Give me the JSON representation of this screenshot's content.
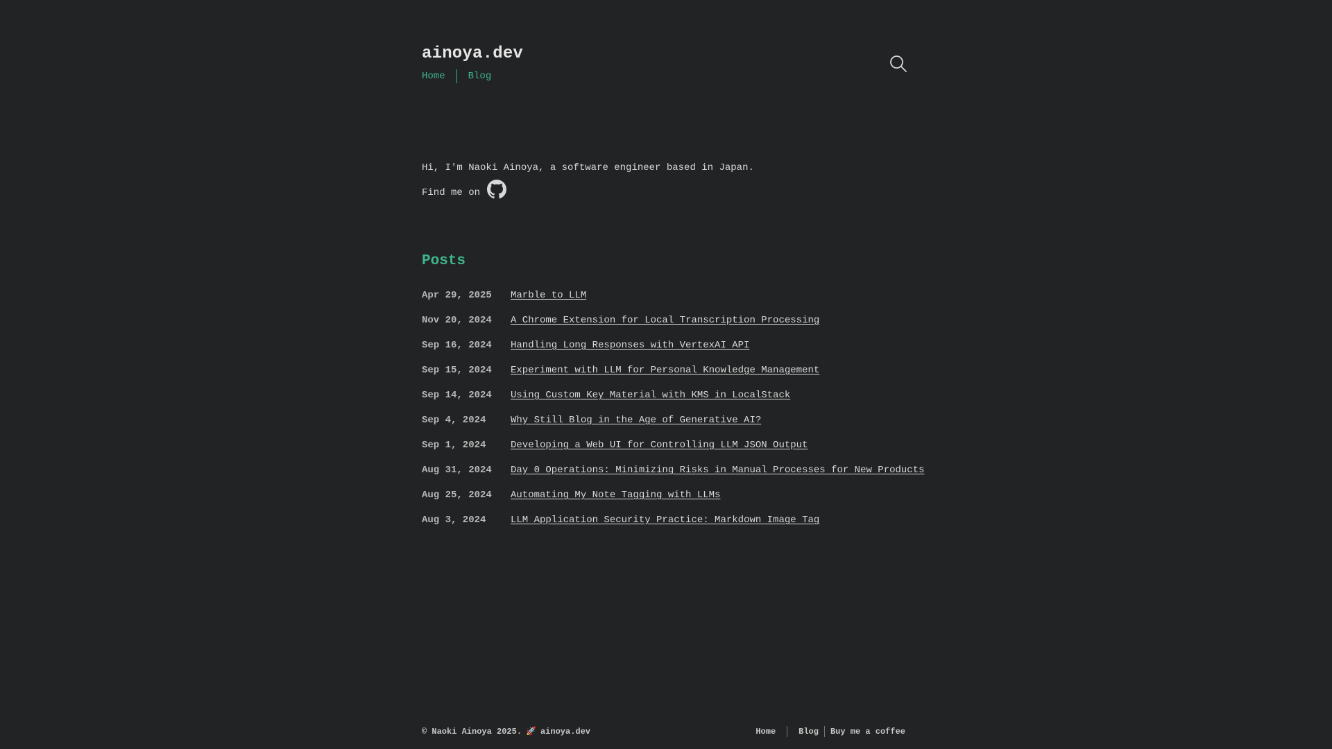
{
  "header": {
    "site_title": "ainoya.dev",
    "nav": [
      {
        "label": "Home"
      },
      {
        "label": "Blog"
      }
    ],
    "search_icon": "search-icon"
  },
  "intro": {
    "text": "Hi, I'm Naoki Ainoya, a software engineer based in Japan.",
    "find_me": "Find me on",
    "github_icon": "github-icon"
  },
  "posts": {
    "title": "Posts",
    "items": [
      {
        "date": "Apr 29, 2025",
        "title": "Marble to LLM"
      },
      {
        "date": "Nov 20, 2024",
        "title": "A Chrome Extension for Local Transcription Processing"
      },
      {
        "date": "Sep 16, 2024",
        "title": "Handling Long Responses with VertexAI API"
      },
      {
        "date": "Sep 15, 2024",
        "title": "Experiment with LLM for Personal Knowledge Management"
      },
      {
        "date": "Sep 14, 2024",
        "title": "Using Custom Key Material with KMS in LocalStack"
      },
      {
        "date": "Sep 4, 2024",
        "title": "Why Still Blog in the Age of Generative AI?"
      },
      {
        "date": "Sep 1, 2024",
        "title": "Developing a Web UI for Controlling LLM JSON Output"
      },
      {
        "date": "Aug 31, 2024",
        "title": "Day 0 Operations: Minimizing Risks in Manual Processes for New Products"
      },
      {
        "date": "Aug 25, 2024",
        "title": "Automating My Note Tagging with LLMs"
      },
      {
        "date": "Aug 3, 2024",
        "title": "LLM Application Security Practice: Markdown Image Tag"
      }
    ]
  },
  "footer": {
    "copyright": "© Naoki Ainoya 2025.",
    "rocket": "🚀",
    "site": "ainoya.dev",
    "nav": [
      {
        "label": "Home"
      },
      {
        "label": "Blog"
      },
      {
        "label": "Buy me a coffee"
      }
    ]
  },
  "colors": {
    "background": "#222324",
    "accent": "#3fb58d",
    "text": "#d9d9d9"
  }
}
